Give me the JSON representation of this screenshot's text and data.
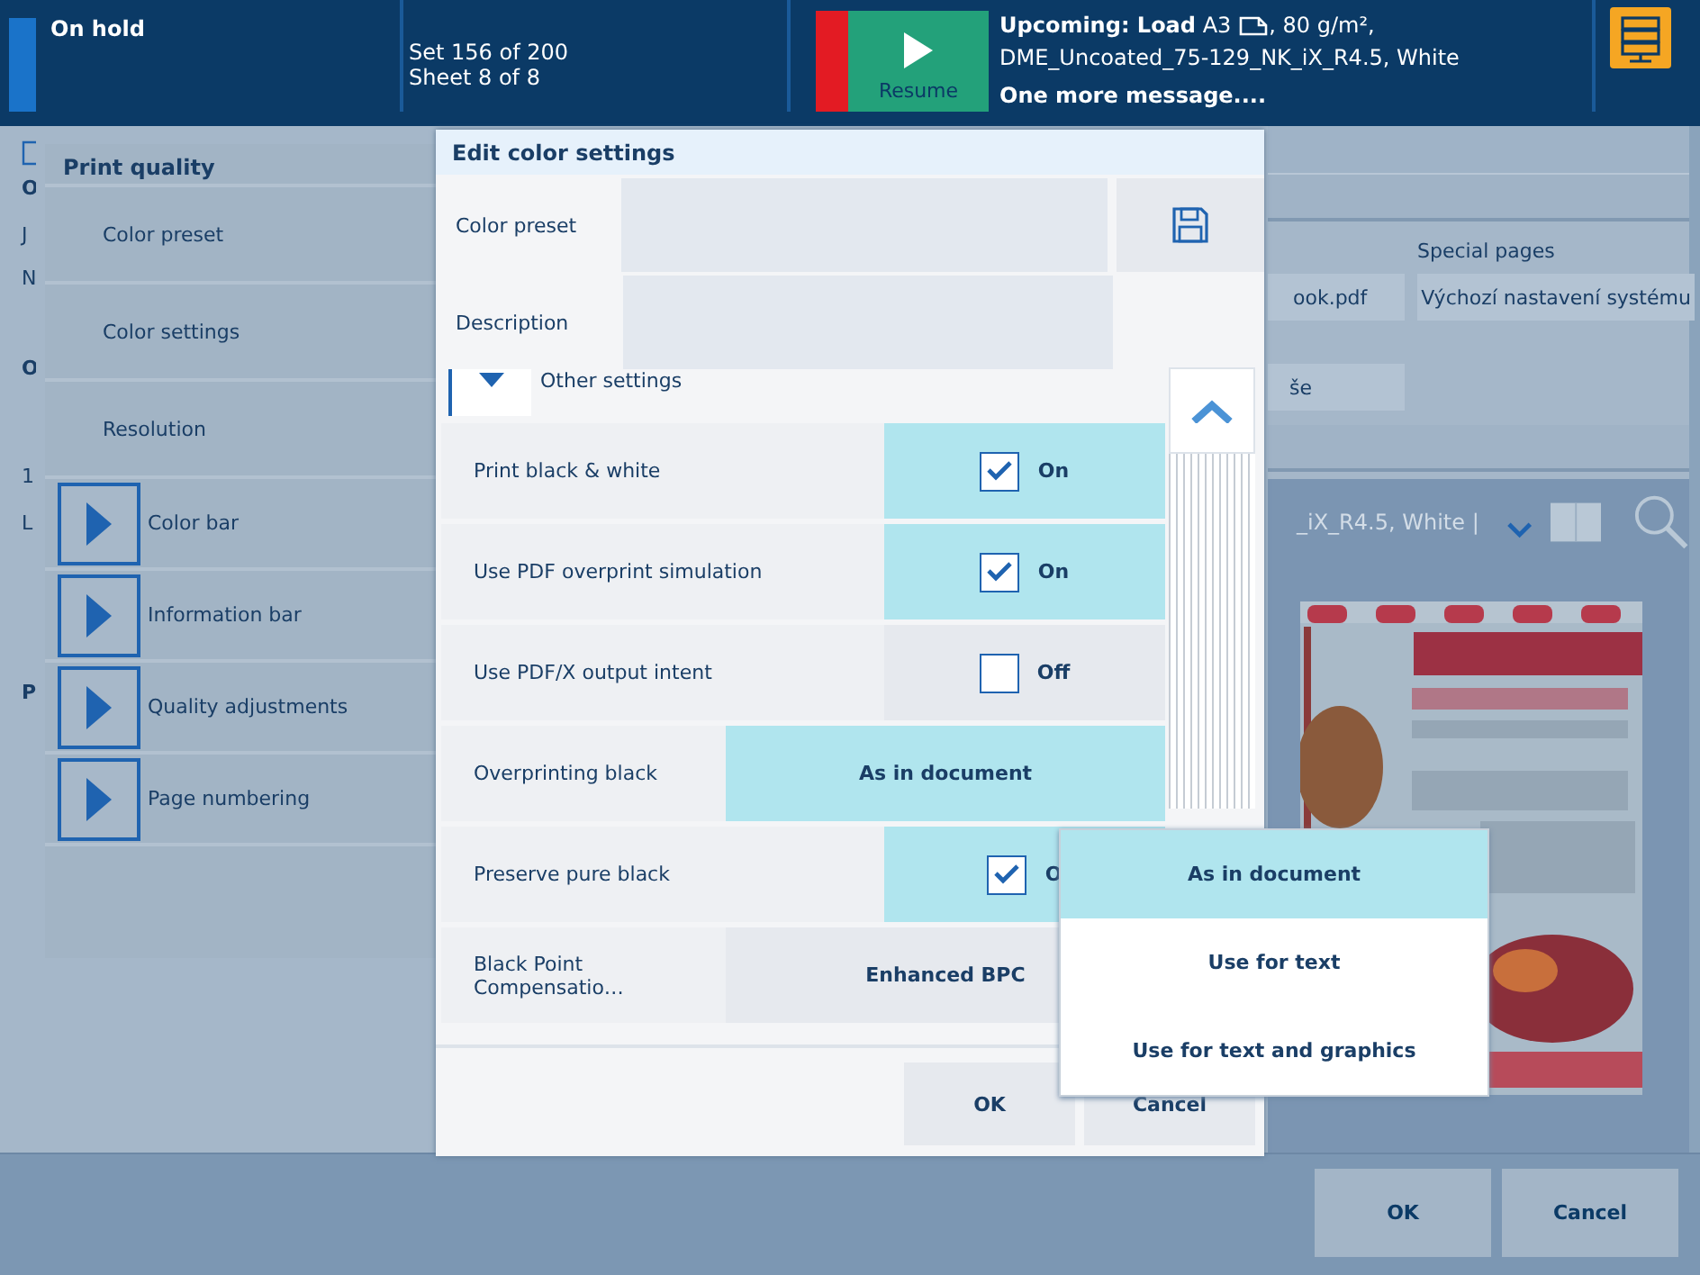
{
  "header": {
    "status": "On hold",
    "set": "Set 156 of 200",
    "sheet": "Sheet 8 of 8",
    "resume_button": "Resume",
    "upcoming_start": "**Upcoming: Load** A3",
    "upcoming_end": ", 80 g/m²,",
    "upcoming_line2": "DME_Uncoated_75-129_NK_iX_R4.5, White",
    "more_messages": "One more message...."
  },
  "background": {
    "left_fragments": [
      "O",
      "J",
      "N",
      "O",
      "1",
      "L",
      "P"
    ],
    "file_field": "ook.pdf",
    "special_pages_label": "Special pages",
    "special_pages_value": "Výchozí nastavení systému",
    "field_fragment": "še",
    "media_text": "_iX_R4.5, White |",
    "buttons": [
      "OK",
      "Cancel"
    ]
  },
  "print_quality": {
    "title": "Print quality",
    "items": [
      {
        "label": "Color preset",
        "kind": "plain"
      },
      {
        "label": "Color settings",
        "kind": "plain"
      },
      {
        "label": "Resolution",
        "kind": "plain"
      },
      {
        "label": "Color bar",
        "kind": "expander"
      },
      {
        "label": "Information bar",
        "kind": "expander"
      },
      {
        "label": "Quality adjustments",
        "kind": "expander"
      },
      {
        "label": "Page numbering",
        "kind": "expander"
      }
    ]
  },
  "dialog": {
    "title": "Edit color settings",
    "fields": [
      {
        "label": "Color preset",
        "kind": "preset"
      },
      {
        "label": "Description",
        "kind": "text"
      }
    ],
    "section": "Other settings",
    "rows": [
      {
        "label": "Print black & white",
        "kind": "toggle",
        "checked": true,
        "value": "On"
      },
      {
        "label": "Use PDF overprint simulation",
        "kind": "toggle",
        "checked": true,
        "value": "On"
      },
      {
        "label": "Use PDF/X output intent",
        "kind": "toggle",
        "checked": false,
        "value": "Off"
      },
      {
        "label": "Overprinting black",
        "kind": "choice",
        "open": true,
        "value": "As in document"
      },
      {
        "label": "Preserve pure black",
        "kind": "toggle",
        "checked": true,
        "value": "O"
      },
      {
        "label": "Black Point Compensatio…",
        "kind": "choice",
        "open": false,
        "value": "Enhanced BPC"
      }
    ],
    "buttons": [
      "OK",
      "Cancel"
    ]
  },
  "menu": {
    "options": [
      {
        "label": "As in document",
        "selected": true
      },
      {
        "label": "Use for text",
        "selected": false
      },
      {
        "label": "Use for text and graphics",
        "selected": false
      }
    ]
  }
}
